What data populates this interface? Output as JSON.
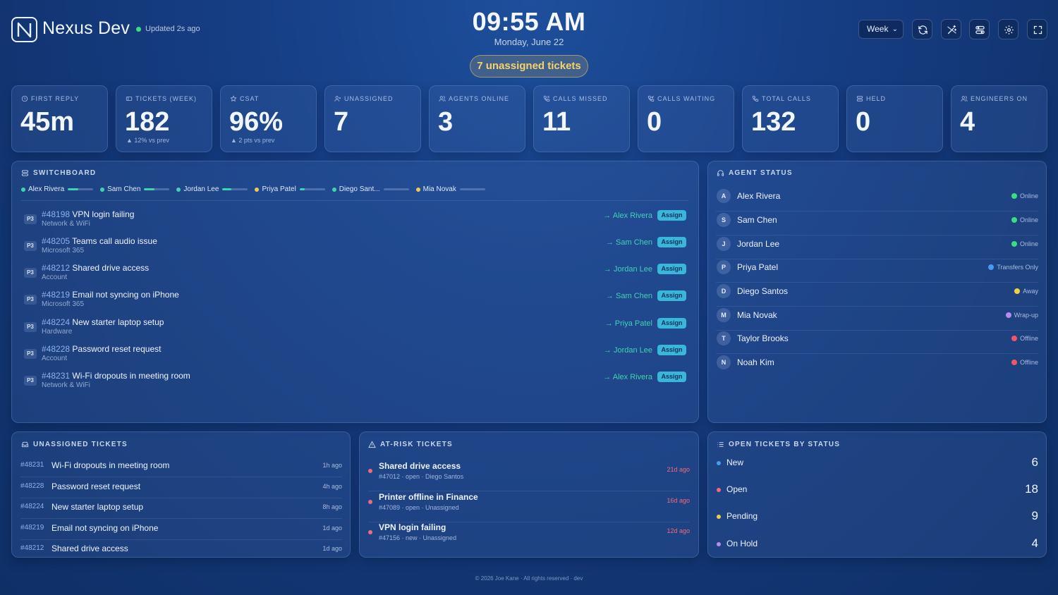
{
  "header": {
    "brand": "Nexus Dev",
    "updated": "Updated 2s ago",
    "time": "09:55 AM",
    "date": "Monday, June 22",
    "unassigned_pill": "7 unassigned tickets",
    "range_select": "Week",
    "icons": [
      "refresh-icon",
      "magic-wand-icon",
      "switchboard-icon",
      "settings-icon",
      "fullscreen-icon"
    ]
  },
  "kpis": [
    {
      "label": "FIRST REPLY",
      "value": "45m",
      "sub": "",
      "icon": "clock-icon"
    },
    {
      "label": "TICKETS (WEEK)",
      "value": "182",
      "sub": "▲ 12% vs prev",
      "icon": "ticket-icon"
    },
    {
      "label": "CSAT",
      "value": "96%",
      "sub": "▲ 2 pts vs prev",
      "icon": "star-icon"
    },
    {
      "label": "UNASSIGNED",
      "value": "7",
      "sub": "",
      "icon": "user-x-icon"
    },
    {
      "label": "AGENTS ONLINE",
      "value": "3",
      "sub": "",
      "icon": "users-icon"
    },
    {
      "label": "CALLS MISSED",
      "value": "11",
      "sub": "",
      "icon": "phone-missed-icon"
    },
    {
      "label": "CALLS WAITING",
      "value": "0",
      "sub": "",
      "icon": "phone-incoming-icon"
    },
    {
      "label": "TOTAL CALLS",
      "value": "132",
      "sub": "",
      "icon": "phone-icon"
    },
    {
      "label": "HELD",
      "value": "0",
      "sub": "",
      "icon": "pause-icon"
    },
    {
      "label": "ENGINEERS ON",
      "value": "4",
      "sub": "",
      "icon": "users-icon"
    }
  ],
  "switchboard": {
    "title": "SWITCHBOARD",
    "legend": [
      {
        "name": "Alex Rivera",
        "color": "#3fd3b3",
        "load": 0.4
      },
      {
        "name": "Sam Chen",
        "color": "#3fd3b3",
        "load": 0.4
      },
      {
        "name": "Jordan Lee",
        "color": "#3fd3b3",
        "load": 0.35
      },
      {
        "name": "Priya Patel",
        "color": "#f2c94c",
        "load": 0.2
      },
      {
        "name": "Diego Sant...",
        "color": "#3fd3b3",
        "load": 0
      },
      {
        "name": "Mia Novak",
        "color": "#f2c94c",
        "load": 0
      }
    ],
    "rows": [
      {
        "prio": "P3",
        "id": "#48198",
        "title": "VPN login failing",
        "category": "Network & WiFi",
        "agent": "→ Alex Rivera",
        "action": "Assign"
      },
      {
        "prio": "P3",
        "id": "#48205",
        "title": "Teams call audio issue",
        "category": "Microsoft 365",
        "agent": "→ Sam Chen",
        "action": "Assign"
      },
      {
        "prio": "P3",
        "id": "#48212",
        "title": "Shared drive access",
        "category": "Account",
        "agent": "→ Jordan Lee",
        "action": "Assign"
      },
      {
        "prio": "P3",
        "id": "#48219",
        "title": "Email not syncing on iPhone",
        "category": "Microsoft 365",
        "agent": "→ Sam Chen",
        "action": "Assign"
      },
      {
        "prio": "P3",
        "id": "#48224",
        "title": "New starter laptop setup",
        "category": "Hardware",
        "agent": "→ Priya Patel",
        "action": "Assign"
      },
      {
        "prio": "P3",
        "id": "#48228",
        "title": "Password reset request",
        "category": "Account",
        "agent": "→ Jordan Lee",
        "action": "Assign"
      },
      {
        "prio": "P3",
        "id": "#48231",
        "title": "Wi-Fi dropouts in meeting room",
        "category": "Network & WiFi",
        "agent": "→ Alex Rivera",
        "action": "Assign"
      }
    ]
  },
  "agent_status": {
    "title": "AGENT STATUS",
    "agents": [
      {
        "initial": "A",
        "name": "Alex Rivera",
        "status": "Online",
        "color": "#3ddc84"
      },
      {
        "initial": "S",
        "name": "Sam Chen",
        "status": "Online",
        "color": "#3ddc84"
      },
      {
        "initial": "J",
        "name": "Jordan Lee",
        "status": "Online",
        "color": "#3ddc84"
      },
      {
        "initial": "P",
        "name": "Priya Patel",
        "status": "Transfers Only",
        "color": "#4a9bf0"
      },
      {
        "initial": "D",
        "name": "Diego Santos",
        "status": "Away",
        "color": "#f2d23c"
      },
      {
        "initial": "M",
        "name": "Mia Novak",
        "status": "Wrap-up",
        "color": "#b58cf0"
      },
      {
        "initial": "T",
        "name": "Taylor Brooks",
        "status": "Offline",
        "color": "#f0566a"
      },
      {
        "initial": "N",
        "name": "Noah Kim",
        "status": "Offline",
        "color": "#f0566a"
      }
    ]
  },
  "unassigned": {
    "title": "UNASSIGNED TICKETS",
    "rows": [
      {
        "id": "#48231",
        "title": "Wi-Fi dropouts in meeting room",
        "ago": "1h ago"
      },
      {
        "id": "#48228",
        "title": "Password reset request",
        "ago": "4h ago"
      },
      {
        "id": "#48224",
        "title": "New starter laptop setup",
        "ago": "8h ago"
      },
      {
        "id": "#48219",
        "title": "Email not syncing on iPhone",
        "ago": "1d ago"
      },
      {
        "id": "#48212",
        "title": "Shared drive access",
        "ago": "1d ago"
      }
    ]
  },
  "at_risk": {
    "title": "AT-RISK TICKETS",
    "rows": [
      {
        "title": "Shared drive access",
        "meta": "#47012 · open · Diego Santos",
        "ago": "21d ago"
      },
      {
        "title": "Printer offline in Finance",
        "meta": "#47089 · open · Unassigned",
        "ago": "16d ago"
      },
      {
        "title": "VPN login failing",
        "meta": "#47156 · new · Unassigned",
        "ago": "12d ago"
      }
    ]
  },
  "open_by_status": {
    "title": "OPEN TICKETS BY STATUS",
    "rows": [
      {
        "name": "New",
        "count": "6",
        "color": "#4a9bf0"
      },
      {
        "name": "Open",
        "count": "18",
        "color": "#f06b7a"
      },
      {
        "name": "Pending",
        "count": "9",
        "color": "#f2c94c"
      },
      {
        "name": "On Hold",
        "count": "4",
        "color": "#b58cf0"
      }
    ]
  },
  "footer": "© 2026 Joe Kane · All rights reserved · dev"
}
